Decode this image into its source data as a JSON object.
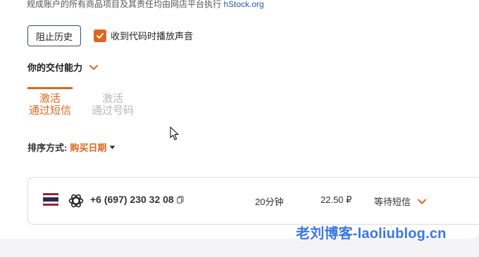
{
  "notice": {
    "text": "规成账户的所有商品项目及其责任均由网店平台执行",
    "link": "hStock.org"
  },
  "history_button": "阻止历史",
  "sound_checkbox": {
    "label": "收到代码时播放声音",
    "checked": true
  },
  "section": {
    "title": "你的交付能力"
  },
  "tabs": [
    {
      "line1": "激活",
      "line2": "通过短信",
      "active": true
    },
    {
      "line1": "激活",
      "line2": "通过号码",
      "active": false
    }
  ],
  "sort": {
    "label": "排序方式:",
    "value": "购买日期"
  },
  "orders": [
    {
      "flag": "thailand-flag",
      "service": "openai-icon",
      "phone": "+6 (697) 230 32 08",
      "duration": "20分钟",
      "price": "22.50 ₽",
      "status": "等待短信"
    }
  ],
  "watermark": "老刘博客-laoliublog.cn",
  "colors": {
    "accent": "#e0651d",
    "watermark": "#3b76e6"
  }
}
